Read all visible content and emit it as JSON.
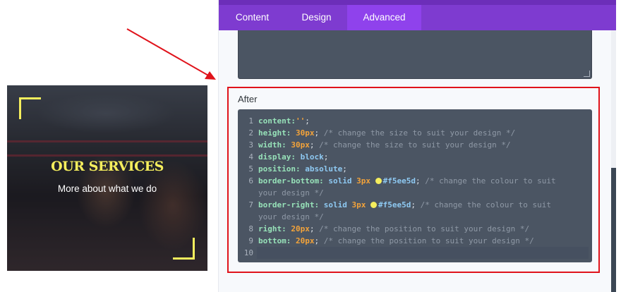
{
  "preview": {
    "title": "OUR SERVICES",
    "subtitle": "More about what we do",
    "accent_color": "#f5ee5d"
  },
  "tabs": [
    {
      "label": "Content",
      "active": false
    },
    {
      "label": "Design",
      "active": false
    },
    {
      "label": "Advanced",
      "active": true
    }
  ],
  "after_label": "After",
  "code_lines": [
    {
      "n": "1",
      "tokens": [
        {
          "t": "content:",
          "c": "p"
        },
        {
          "t": "''",
          "c": "s"
        },
        {
          "t": ";",
          "c": "pu"
        }
      ]
    },
    {
      "n": "2",
      "tokens": [
        {
          "t": "height: ",
          "c": "p"
        },
        {
          "t": "30px",
          "c": "v"
        },
        {
          "t": "; ",
          "c": "pu"
        },
        {
          "t": "/* change the size to suit your design */",
          "c": "c"
        }
      ]
    },
    {
      "n": "3",
      "tokens": [
        {
          "t": "width: ",
          "c": "p"
        },
        {
          "t": "30px",
          "c": "v"
        },
        {
          "t": "; ",
          "c": "pu"
        },
        {
          "t": "/* change the size to suit your design */",
          "c": "c"
        }
      ]
    },
    {
      "n": "4",
      "tokens": [
        {
          "t": "display: ",
          "c": "p"
        },
        {
          "t": "block",
          "c": "k"
        },
        {
          "t": ";",
          "c": "pu"
        }
      ]
    },
    {
      "n": "5",
      "tokens": [
        {
          "t": "position: ",
          "c": "p"
        },
        {
          "t": "absolute",
          "c": "k"
        },
        {
          "t": ";",
          "c": "pu"
        }
      ]
    },
    {
      "n": "6",
      "tokens": [
        {
          "t": "border-bottom: ",
          "c": "p"
        },
        {
          "t": "solid ",
          "c": "k"
        },
        {
          "t": "3px ",
          "c": "v"
        },
        {
          "t": "",
          "c": "sw"
        },
        {
          "t": "#f5ee5d",
          "c": "k"
        },
        {
          "t": "; ",
          "c": "pu"
        },
        {
          "t": "/* change the colour to suit",
          "c": "c"
        }
      ]
    },
    {
      "n": "",
      "tokens": [
        {
          "t": "your design */",
          "c": "c"
        }
      ]
    },
    {
      "n": "7",
      "tokens": [
        {
          "t": "border-right: ",
          "c": "p"
        },
        {
          "t": "solid ",
          "c": "k"
        },
        {
          "t": "3px ",
          "c": "v"
        },
        {
          "t": "",
          "c": "sw"
        },
        {
          "t": "#f5ee5d",
          "c": "k"
        },
        {
          "t": "; ",
          "c": "pu"
        },
        {
          "t": "/* change the colour to suit",
          "c": "c"
        }
      ]
    },
    {
      "n": "",
      "tokens": [
        {
          "t": "your design */",
          "c": "c"
        }
      ]
    },
    {
      "n": "8",
      "tokens": [
        {
          "t": "right: ",
          "c": "p"
        },
        {
          "t": "20px",
          "c": "v"
        },
        {
          "t": "; ",
          "c": "pu"
        },
        {
          "t": "/* change the position to suit your design */",
          "c": "c"
        }
      ]
    },
    {
      "n": "9",
      "tokens": [
        {
          "t": "bottom: ",
          "c": "p"
        },
        {
          "t": "20px",
          "c": "v"
        },
        {
          "t": "; ",
          "c": "pu"
        },
        {
          "t": "/* change the position to suit your design */",
          "c": "c"
        }
      ]
    },
    {
      "n": "10",
      "tokens": []
    }
  ],
  "colors": {
    "tab_bar": "#7e3bd0",
    "tab_active": "#8f42ec",
    "editor_bg": "#4b5563",
    "highlight_box": "#e0131b",
    "arrow": "#e0131b"
  }
}
